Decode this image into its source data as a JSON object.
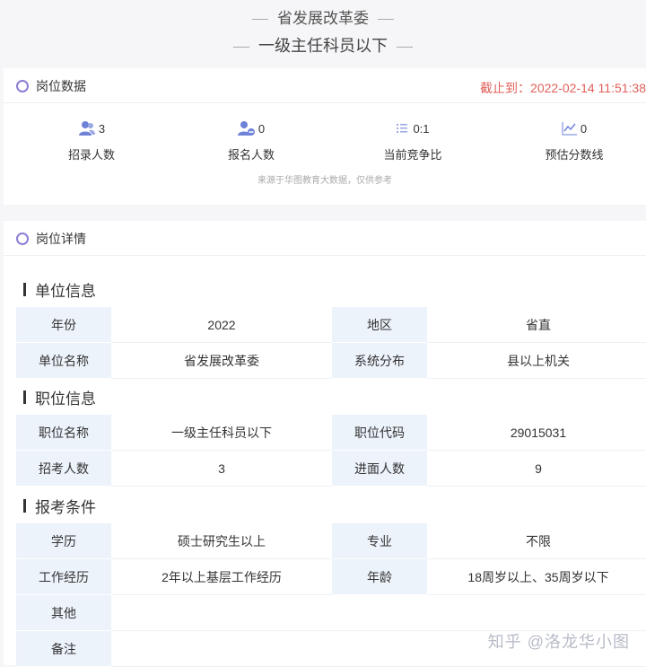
{
  "header": {
    "org": "省发展改革委",
    "position": "一级主任科员以下"
  },
  "data_card": {
    "title": "岗位数据",
    "deadline": "截止到：2022-02-14 11:51:38",
    "stats": [
      {
        "icon": "users-icon",
        "value": "3",
        "label": "招录人数"
      },
      {
        "icon": "user-minus-icon",
        "value": "0",
        "label": "报名人数"
      },
      {
        "icon": "ratio-list-icon",
        "value": "0:1",
        "label": "当前竞争比"
      },
      {
        "icon": "line-chart-icon",
        "value": "0",
        "label": "预估分数线"
      }
    ],
    "note": "来源于华图教育大数据，仅供参考"
  },
  "detail_card": {
    "title": "岗位详情",
    "sections": [
      {
        "title": "单位信息",
        "rows": [
          {
            "k1": "年份",
            "v1": "2022",
            "k2": "地区",
            "v2": "省直"
          },
          {
            "k1": "单位名称",
            "v1": "省发展改革委",
            "k2": "系统分布",
            "v2": "县以上机关"
          }
        ]
      },
      {
        "title": "职位信息",
        "rows": [
          {
            "k1": "职位名称",
            "v1": "一级主任科员以下",
            "k2": "职位代码",
            "v2": "29015031"
          },
          {
            "k1": "招考人数",
            "v1": "3",
            "k2": "进面人数",
            "v2": "9"
          }
        ]
      },
      {
        "title": "报考条件",
        "rows": [
          {
            "k1": "学历",
            "v1": "硕士研究生以上",
            "k2": "专业",
            "v2": "不限"
          },
          {
            "k1": "工作经历",
            "v1": "2年以上基层工作经历",
            "k2": "年龄",
            "v2": "18周岁以上、35周岁以下"
          }
        ],
        "single_rows": [
          {
            "k": "其他",
            "v": ""
          },
          {
            "k": "备注",
            "v": ""
          }
        ]
      }
    ]
  },
  "watermark": "知乎 @洛龙华小图",
  "colors": {
    "accent": "#8b7fd6",
    "icon": "#6e82d8",
    "deadline": "#e0605a",
    "key_bg": "#edf3fb"
  }
}
